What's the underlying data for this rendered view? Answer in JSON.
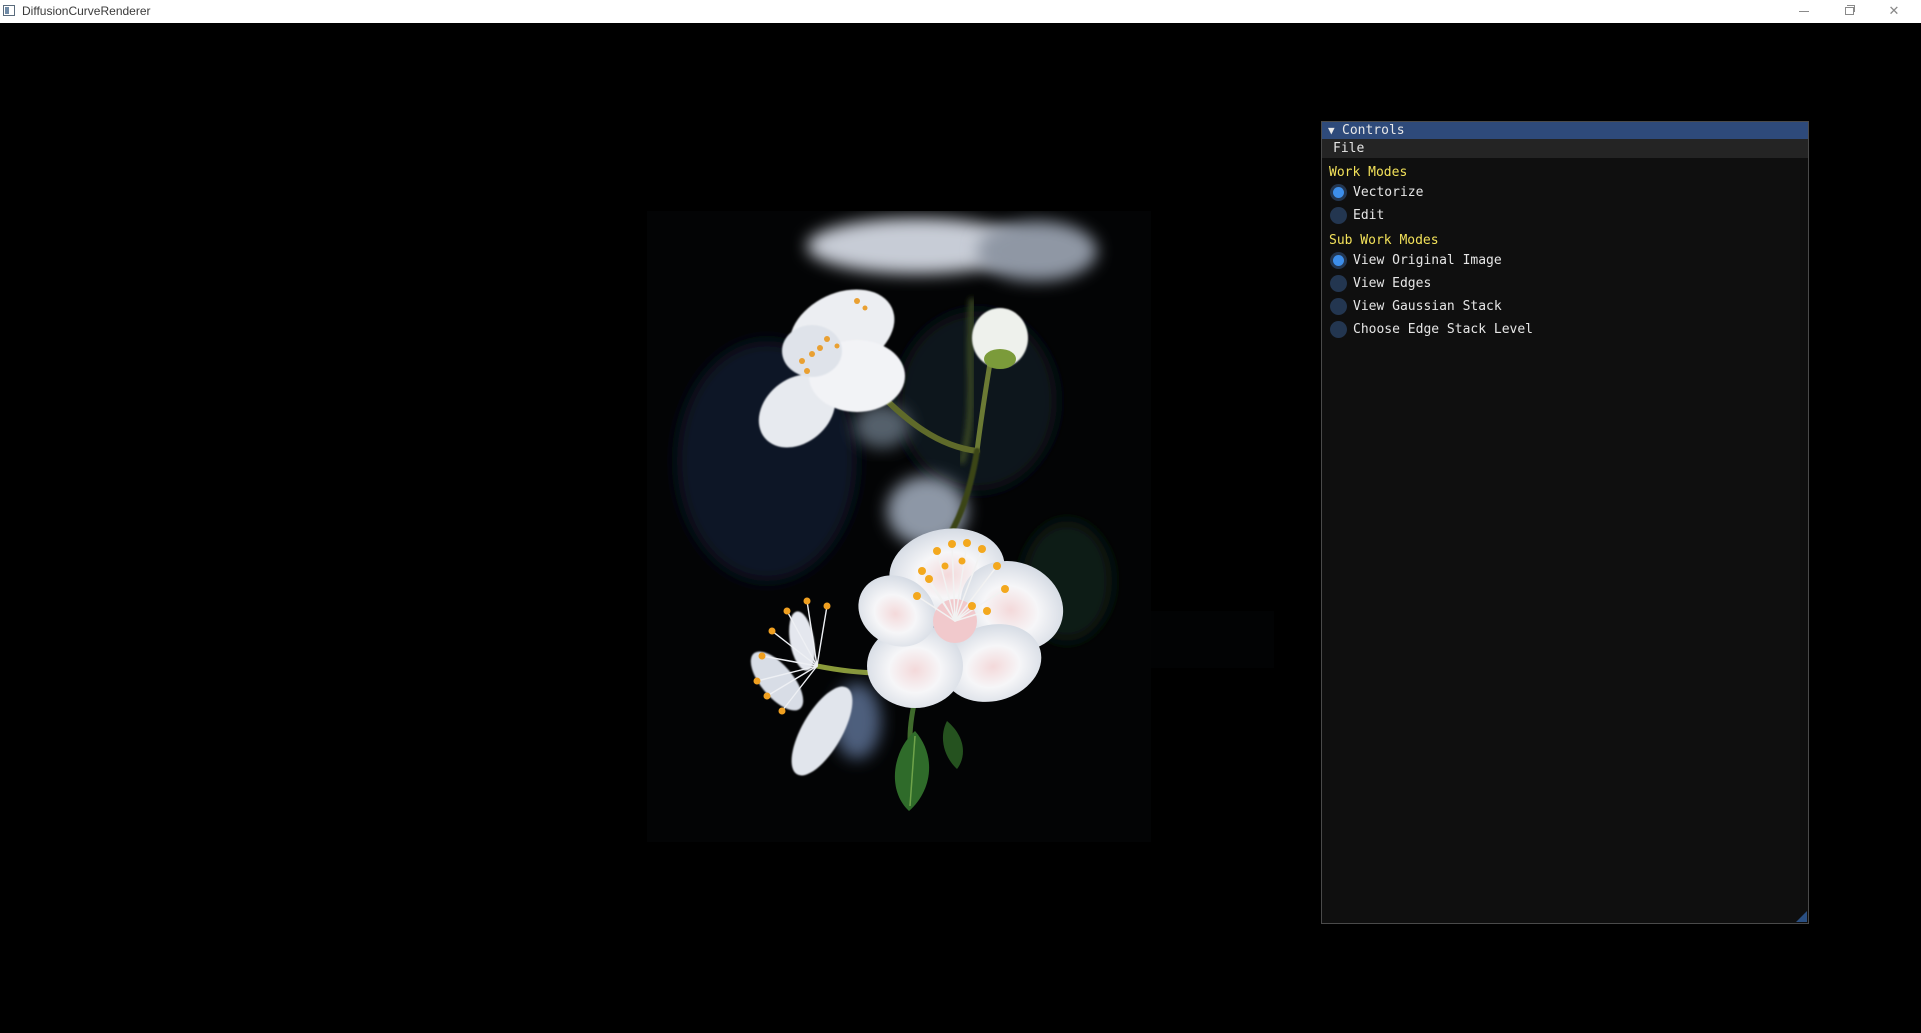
{
  "window": {
    "title": "DiffusionCurveRenderer"
  },
  "controls_panel": {
    "title": "Controls",
    "menu": [
      "File"
    ],
    "work_modes": {
      "label": "Work Modes",
      "options": [
        {
          "label": "Vectorize",
          "selected": true
        },
        {
          "label": "Edit",
          "selected": false
        }
      ]
    },
    "sub_work_modes": {
      "label": "Sub Work Modes",
      "options": [
        {
          "label": "View Original Image",
          "selected": true
        },
        {
          "label": "View Edges",
          "selected": false
        },
        {
          "label": "View Gaussian Stack",
          "selected": false
        },
        {
          "label": "Choose Edge Stack Level",
          "selected": false
        }
      ]
    }
  },
  "colors": {
    "viewport_background": "#000000",
    "panel_header": "#2e4a7a",
    "section_label": "#f3e25a",
    "radio_checked": "#3d8eea",
    "radio_unchecked": "#233650"
  }
}
